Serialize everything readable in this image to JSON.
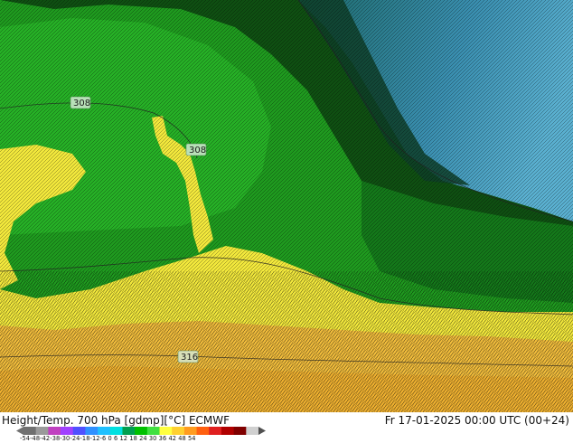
{
  "title_left": "Height/Temp. 700 hPa [gdmp][°C] ECMWF",
  "title_right": "Fr 17-01-2025 00:00 UTC (00+24)",
  "contour_labels": [
    "308",
    "308",
    "316"
  ],
  "colorbar": {
    "ticks": "-54-48-42-38-30-24-18-12-6 0 6 12 18 24 30 36 42 48 54",
    "colors": [
      "#707070",
      "#9a9a9a",
      "#c040c0",
      "#a040ff",
      "#5050ff",
      "#3090ff",
      "#20c0ff",
      "#00e0e0",
      "#00a050",
      "#00c000",
      "#40e040",
      "#ffff40",
      "#ffd030",
      "#ff9c20",
      "#ff6010",
      "#e02020",
      "#b00000",
      "#800000",
      "#d0d0d0"
    ]
  },
  "colors": {
    "cold_blue": "#3a8fb0",
    "dark_green": "#0b3d0b",
    "mid_green": "#1f9a1f",
    "bright_green": "#2ec52e",
    "yellow": "#f2e83c",
    "orange": "#f0b83a"
  }
}
